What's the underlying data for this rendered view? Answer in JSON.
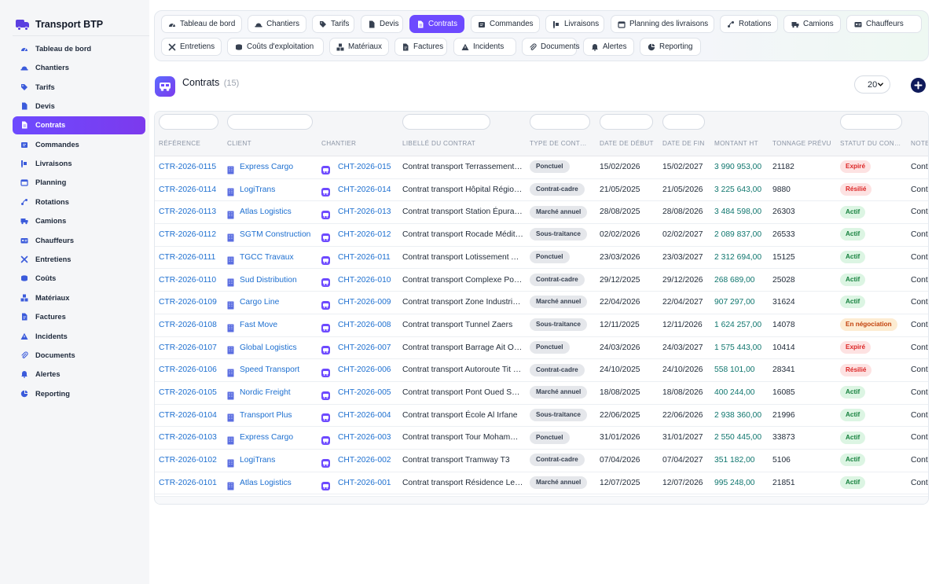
{
  "app": {
    "title": "Transport BTP"
  },
  "colors": {
    "accent": "#6d4aff",
    "link": "#1d6fd0",
    "amount": "#0f766e"
  },
  "sidebar": {
    "items": [
      {
        "label": "Tableau de bord",
        "icon": "dashboard-icon"
      },
      {
        "label": "Chantiers",
        "icon": "helmet-icon"
      },
      {
        "label": "Tarifs",
        "icon": "tag-icon"
      },
      {
        "label": "Devis",
        "icon": "file-icon"
      },
      {
        "label": "Contrats",
        "icon": "file-contract-icon",
        "active": true
      },
      {
        "label": "Commandes",
        "icon": "clipboard-icon"
      },
      {
        "label": "Livraisons",
        "icon": "dolly-icon"
      },
      {
        "label": "Planning",
        "icon": "calendar-icon"
      },
      {
        "label": "Rotations",
        "icon": "route-icon"
      },
      {
        "label": "Camions",
        "icon": "truck-icon"
      },
      {
        "label": "Chauffeurs",
        "icon": "id-card-icon"
      },
      {
        "label": "Entretiens",
        "icon": "tools-icon"
      },
      {
        "label": "Coûts",
        "icon": "coins-icon"
      },
      {
        "label": "Matériaux",
        "icon": "cubes-icon"
      },
      {
        "label": "Factures",
        "icon": "invoice-icon"
      },
      {
        "label": "Incidents",
        "icon": "warning-icon"
      },
      {
        "label": "Documents",
        "icon": "paperclip-icon"
      },
      {
        "label": "Alertes",
        "icon": "bell-icon"
      },
      {
        "label": "Reporting",
        "icon": "chart-pie-icon"
      }
    ]
  },
  "tabs": [
    {
      "label": "Tableau de bord",
      "icon": "dashboard-icon"
    },
    {
      "label": "Chantiers",
      "icon": "helmet-icon"
    },
    {
      "label": "Tarifs",
      "icon": "tag-icon"
    },
    {
      "label": "Devis",
      "icon": "file-icon"
    },
    {
      "label": "Contrats",
      "icon": "file-contract-icon",
      "active": true
    },
    {
      "label": "Commandes",
      "icon": "clipboard-icon"
    },
    {
      "label": "Livraisons",
      "icon": "dolly-icon"
    },
    {
      "label": "Planning des livraisons",
      "icon": "calendar-icon"
    },
    {
      "label": "Rotations",
      "icon": "route-icon"
    },
    {
      "label": "Camions",
      "icon": "truck-icon"
    },
    {
      "label": "Chauffeurs",
      "icon": "id-card-icon"
    },
    {
      "label": "Entretiens",
      "icon": "tools-icon"
    },
    {
      "label": "Coûts d'exploitation",
      "icon": "coins-icon"
    },
    {
      "label": "Matériaux",
      "icon": "cubes-icon"
    },
    {
      "label": "Factures",
      "icon": "invoice-icon"
    },
    {
      "label": "Incidents",
      "icon": "warning-icon"
    },
    {
      "label": "Documents",
      "icon": "paperclip-icon"
    },
    {
      "label": "Alertes",
      "icon": "bell-icon"
    },
    {
      "label": "Reporting",
      "icon": "chart-pie-icon"
    }
  ],
  "page": {
    "title": "Contrats",
    "count": "(15)",
    "per_page": "20"
  },
  "table": {
    "columns": [
      "RÉFÉRENCE",
      "CLIENT",
      "CHANTIER",
      "LIBELLÉ DU CONTRAT",
      "TYPE DE CONTRAT",
      "DATE DE DÉBUT",
      "DATE DE FIN",
      "MONTANT HT",
      "TONNAGE PRÉVU",
      "STATUT DU CONTRAT",
      "NOTES"
    ],
    "rows": [
      {
        "ref": "CTR-2026-0115",
        "client": "Express Cargo",
        "chantier": "CHT-2026-015",
        "libelle": "Contrat transport Terrassement Ouarzazate",
        "type": "Ponctuel",
        "debut": "15/02/2026",
        "fin": "15/02/2027",
        "montant": "3 990 953,00",
        "tonnage": "21182",
        "statut": "Expiré",
        "statut_class": "expire",
        "notes": "Contrat"
      },
      {
        "ref": "CTR-2026-0114",
        "client": "LogiTrans",
        "chantier": "CHT-2026-014",
        "libelle": "Contrat transport Hôpital Régional",
        "type": "Contrat-cadre",
        "debut": "21/05/2025",
        "fin": "21/05/2026",
        "montant": "3 225 643,00",
        "tonnage": "9880",
        "statut": "Résilié",
        "statut_class": "resilie",
        "notes": "Contrat"
      },
      {
        "ref": "CTR-2026-0113",
        "client": "Atlas Logistics",
        "chantier": "CHT-2026-013",
        "libelle": "Contrat transport Station Épuration",
        "type": "Marché annuel",
        "debut": "28/08/2025",
        "fin": "28/08/2026",
        "montant": "3 484 598,00",
        "tonnage": "26303",
        "statut": "Actif",
        "statut_class": "actif",
        "notes": "Contrat"
      },
      {
        "ref": "CTR-2026-0112",
        "client": "SGTM Construction",
        "chantier": "CHT-2026-012",
        "libelle": "Contrat transport Rocade Méditerranéenne",
        "type": "Sous-traitance",
        "debut": "02/02/2026",
        "fin": "02/02/2027",
        "montant": "2 089 837,00",
        "tonnage": "26533",
        "statut": "Actif",
        "statut_class": "actif",
        "notes": "Contrat"
      },
      {
        "ref": "CTR-2026-0111",
        "client": "TGCC Travaux",
        "chantier": "CHT-2026-011",
        "libelle": "Contrat transport Lotissement Al Amal",
        "type": "Ponctuel",
        "debut": "23/03/2026",
        "fin": "23/03/2027",
        "montant": "2 312 694,00",
        "tonnage": "15125",
        "statut": "Actif",
        "statut_class": "actif",
        "notes": "Contrat"
      },
      {
        "ref": "CTR-2026-0110",
        "client": "Sud Distribution",
        "chantier": "CHT-2026-010",
        "libelle": "Contrat transport Complexe Portuaire",
        "type": "Contrat-cadre",
        "debut": "29/12/2025",
        "fin": "29/12/2026",
        "montant": "268 689,00",
        "tonnage": "25028",
        "statut": "Actif",
        "statut_class": "actif",
        "notes": "Contrat"
      },
      {
        "ref": "CTR-2026-0109",
        "client": "Cargo Line",
        "chantier": "CHT-2026-009",
        "libelle": "Contrat transport Zone Industrielle",
        "type": "Marché annuel",
        "debut": "22/04/2026",
        "fin": "22/04/2027",
        "montant": "907 297,00",
        "tonnage": "31624",
        "statut": "Actif",
        "statut_class": "actif",
        "notes": "Contrat"
      },
      {
        "ref": "CTR-2026-0108",
        "client": "Fast Move",
        "chantier": "CHT-2026-008",
        "libelle": "Contrat transport Tunnel Zaers",
        "type": "Sous-traitance",
        "debut": "12/11/2025",
        "fin": "12/11/2026",
        "montant": "1 624 257,00",
        "tonnage": "14078",
        "statut": "En négociation",
        "statut_class": "nego",
        "notes": "Contrat"
      },
      {
        "ref": "CTR-2026-0107",
        "client": "Global Logistics",
        "chantier": "CHT-2026-007",
        "libelle": "Contrat transport Barrage Ait Ouarda",
        "type": "Ponctuel",
        "debut": "24/03/2026",
        "fin": "24/03/2027",
        "montant": "1 575 443,00",
        "tonnage": "10414",
        "statut": "Expiré",
        "statut_class": "expire",
        "notes": "Contrat"
      },
      {
        "ref": "CTR-2026-0106",
        "client": "Speed Transport",
        "chantier": "CHT-2026-006",
        "libelle": "Contrat transport Autoroute Tit Mellil",
        "type": "Contrat-cadre",
        "debut": "24/10/2025",
        "fin": "24/10/2026",
        "montant": "558 101,00",
        "tonnage": "28341",
        "statut": "Résilié",
        "statut_class": "resilie",
        "notes": "Contrat"
      },
      {
        "ref": "CTR-2026-0105",
        "client": "Nordic Freight",
        "chantier": "CHT-2026-005",
        "libelle": "Contrat transport Pont Oued Sebou",
        "type": "Marché annuel",
        "debut": "18/08/2025",
        "fin": "18/08/2026",
        "montant": "400 244,00",
        "tonnage": "16085",
        "statut": "Actif",
        "statut_class": "actif",
        "notes": "Contrat"
      },
      {
        "ref": "CTR-2026-0104",
        "client": "Transport Plus",
        "chantier": "CHT-2026-004",
        "libelle": "Contrat transport École Al Irfane",
        "type": "Sous-traitance",
        "debut": "22/06/2025",
        "fin": "22/06/2026",
        "montant": "2 938 360,00",
        "tonnage": "21996",
        "statut": "Actif",
        "statut_class": "actif",
        "notes": "Contrat"
      },
      {
        "ref": "CTR-2026-0103",
        "client": "Express Cargo",
        "chantier": "CHT-2026-003",
        "libelle": "Contrat transport Tour Mohammed VI",
        "type": "Ponctuel",
        "debut": "31/01/2026",
        "fin": "31/01/2027",
        "montant": "2 550 445,00",
        "tonnage": "33873",
        "statut": "Actif",
        "statut_class": "actif",
        "notes": "Contrat"
      },
      {
        "ref": "CTR-2026-0102",
        "client": "LogiTrans",
        "chantier": "CHT-2026-002",
        "libelle": "Contrat transport Tramway T3",
        "type": "Contrat-cadre",
        "debut": "07/04/2026",
        "fin": "07/04/2027",
        "montant": "351 182,00",
        "tonnage": "5106",
        "statut": "Actif",
        "statut_class": "actif",
        "notes": "Contrat"
      },
      {
        "ref": "CTR-2026-0101",
        "client": "Atlas Logistics",
        "chantier": "CHT-2026-001",
        "libelle": "Contrat transport Résidence Les Jardins",
        "type": "Marché annuel",
        "debut": "12/07/2025",
        "fin": "12/07/2026",
        "montant": "995 248,00",
        "tonnage": "21851",
        "statut": "Actif",
        "statut_class": "actif",
        "notes": "Contrat"
      }
    ]
  }
}
